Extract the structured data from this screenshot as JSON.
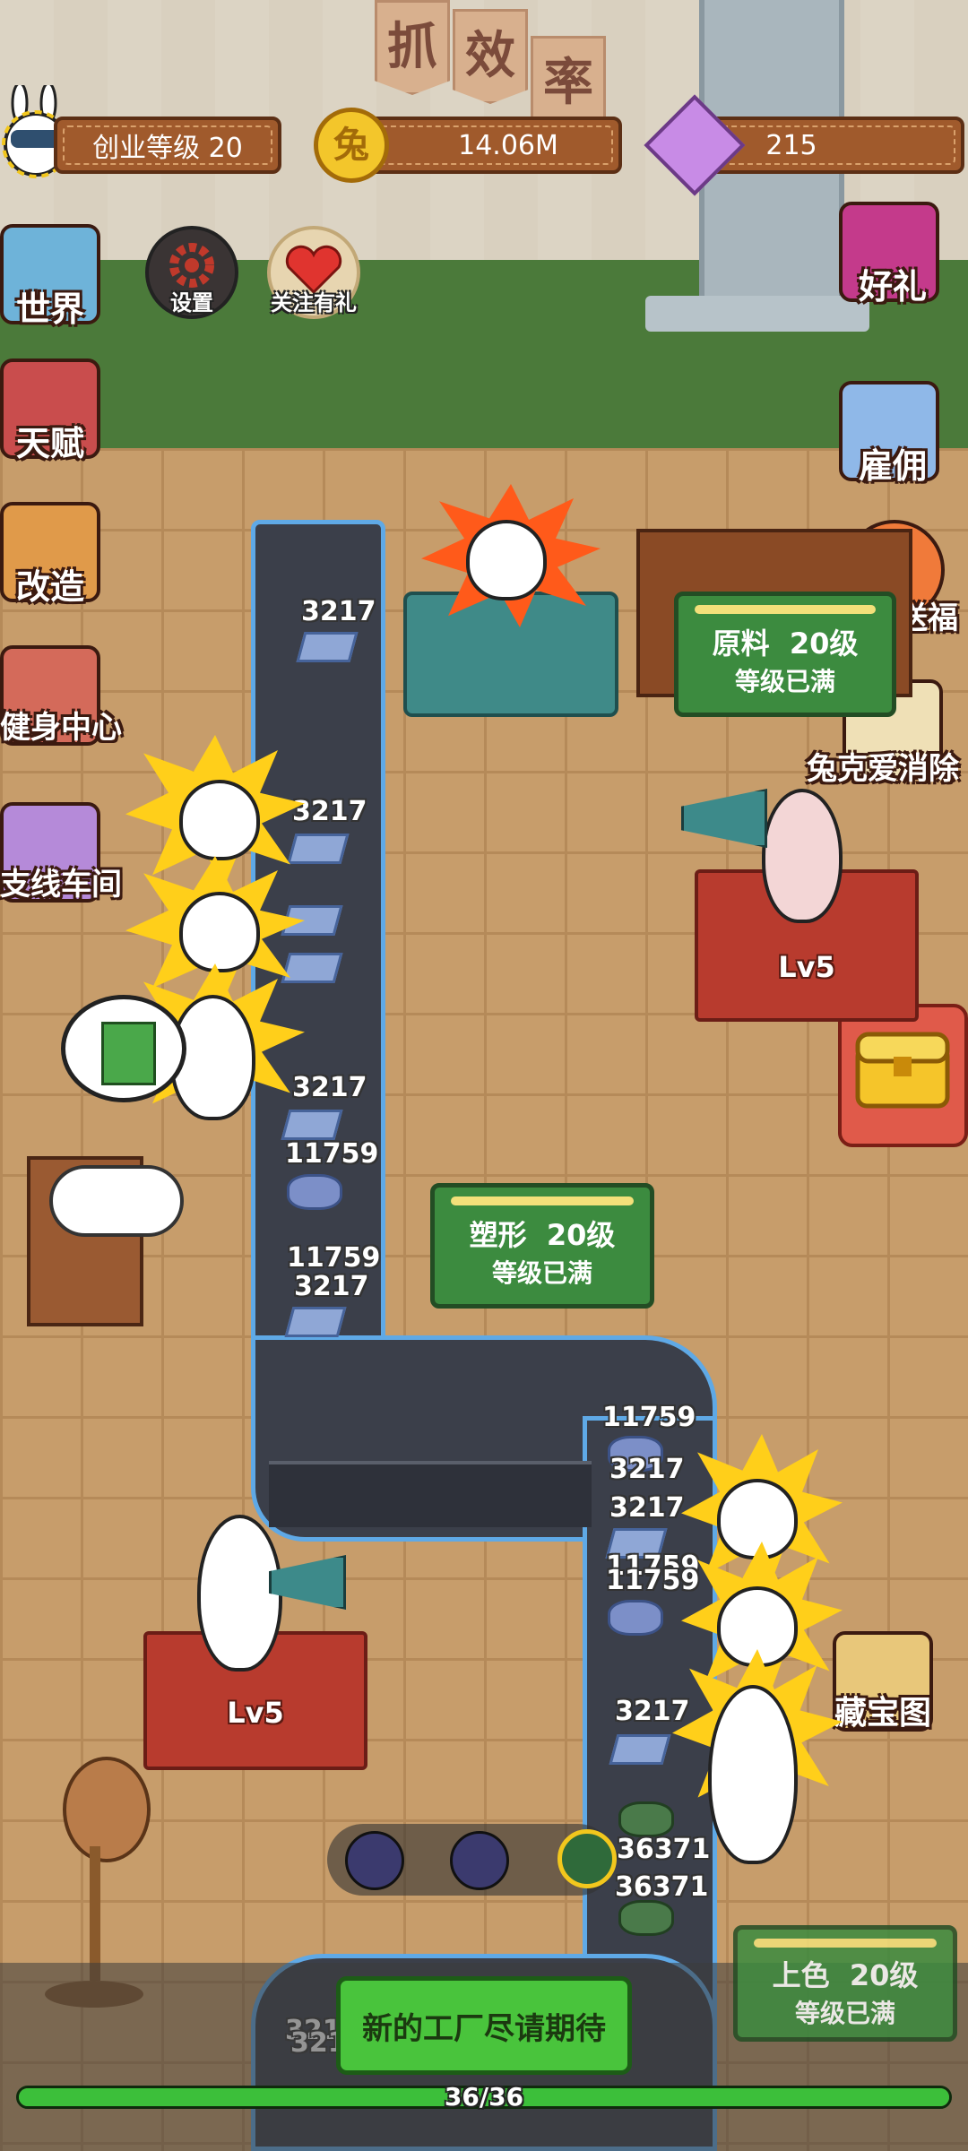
{
  "banner": [
    "抓",
    "效",
    "率"
  ],
  "top_bar": {
    "level_label": "创业等级 20",
    "coins": "14.06M",
    "gems": "215",
    "coin_icon": "rabbit-coin-icon",
    "gem_icon": "purple-gem-icon"
  },
  "left_menu": [
    {
      "label": "世界",
      "icon": "map-icon"
    },
    {
      "label": "天赋",
      "icon": "talent-icon"
    },
    {
      "label": "改造",
      "icon": "paint-roller-icon"
    },
    {
      "label": "健身中心",
      "icon": "gym-icon"
    },
    {
      "label": "支线车间",
      "icon": "branch-workshop-icon"
    }
  ],
  "round_buttons": [
    {
      "label": "设置",
      "icon": "gear-icon"
    },
    {
      "label": "关注有礼",
      "icon": "heart-gift-icon"
    }
  ],
  "right_menu": [
    {
      "label": "好礼",
      "icon": "gift-box-icon"
    },
    {
      "label": "雇佣",
      "icon": "rabbits-icon"
    },
    {
      "label": "玉兔送福",
      "icon": "jade-rabbit-icon"
    },
    {
      "label": "兔克爱消除",
      "icon": "cards-icon"
    },
    {
      "label": "藏宝图",
      "icon": "treasure-map-icon"
    }
  ],
  "stations": {
    "raw": {
      "name": "原料",
      "level": "20级",
      "status": "等级已满"
    },
    "shape": {
      "name": "塑形",
      "level": "20级",
      "status": "等级已满"
    },
    "color": {
      "name": "上色",
      "level": "20级",
      "status": "等级已满"
    }
  },
  "supervisors": [
    {
      "level": "Lv5"
    },
    {
      "level": "Lv5"
    }
  ],
  "belt_numbers": {
    "left": [
      "3217",
      "3217",
      "3217",
      "11759",
      "11759",
      "3217"
    ],
    "right": [
      "11759",
      "3217",
      "3217",
      "11759",
      "11759",
      "3217",
      "36371",
      "36371"
    ],
    "bottom": [
      "321",
      "321"
    ]
  },
  "bottom": {
    "new_factory": "新的工厂尽请期待",
    "progress_text": "36/36",
    "progress": 1.0
  },
  "tools": [
    "gun-tool-icon",
    "wrench-tool-icon",
    "turtle-tool-icon"
  ],
  "colors": {
    "accent_green": "#3c8b3f",
    "belt_border": "#5fa9e6",
    "bar_brown": "#a05a2c"
  }
}
